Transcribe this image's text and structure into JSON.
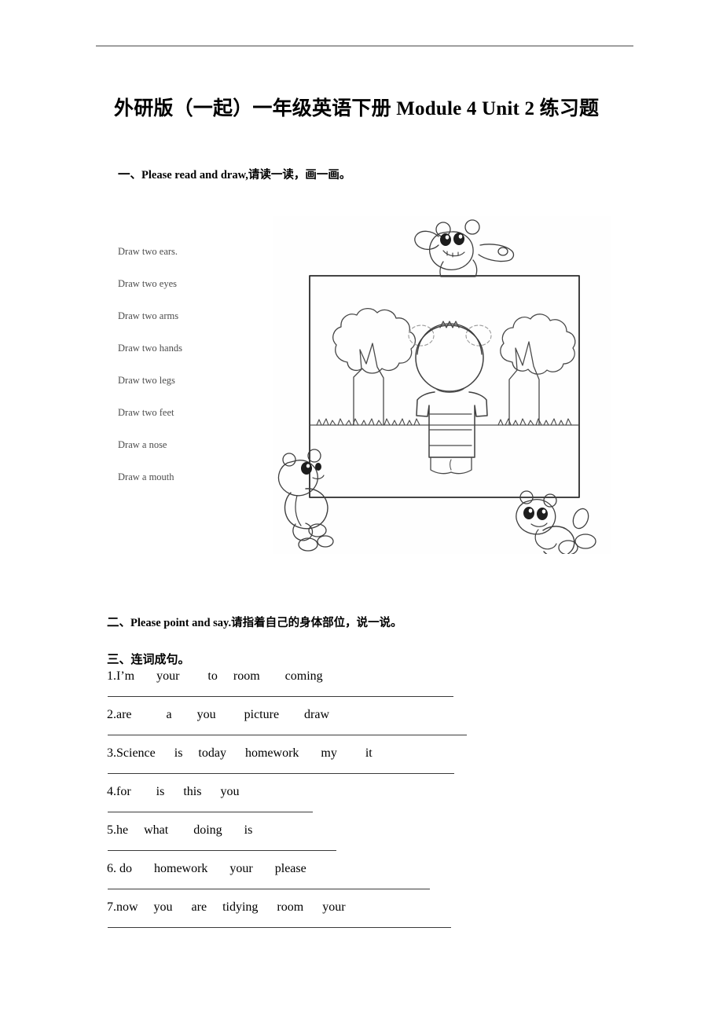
{
  "document": {
    "title": "外研版（一起）一年级英语下册 Module 4 Unit 2 练习题"
  },
  "sections": [
    {
      "number": "一",
      "mark": "、",
      "heading": "Please read and draw,请读一读，画一画。"
    },
    {
      "number": "二",
      "mark": "、",
      "heading": "Please point and say.请指着自己的身体部位，说一说。"
    },
    {
      "number": "三",
      "mark": "、",
      "heading": "连词成句。"
    }
  ],
  "exercise_one": {
    "draw_instructions": [
      "Draw two ears.",
      "Draw two eyes",
      "Draw two arms",
      "Draw two hands",
      "Draw two legs",
      "Draw two feet",
      "Draw a nose",
      "Draw a mouth"
    ],
    "picture_alt": "Line drawing of a child standing in a park with two trees, framed by a picture border, with three teddy bears around the frame"
  },
  "exercise_three": {
    "items": [
      {
        "number": "1.",
        "words": "I’m       your         to     room        coming",
        "line_width": 440
      },
      {
        "number": "2.",
        "words": "are           a        you         picture        draw",
        "line_width": 457
      },
      {
        "number": "3.",
        "words": "Science      is     today      homework       my         it",
        "line_width": 441
      },
      {
        "number": "4.",
        "words": "for        is      this      you",
        "line_width": 261
      },
      {
        "number": "5.",
        "words": "he     what        doing       is",
        "line_width": 291
      },
      {
        "number": "6.",
        "words": " do       homework       your       please",
        "line_width": 410
      },
      {
        "number": "7.",
        "words": "now     you      are     tidying      room      your",
        "line_width": 437
      }
    ]
  },
  "colors": {
    "rule": "#4a4a4a",
    "answer_line": "#3b3b3b",
    "draw_text": "#4c4c4c",
    "ink": "#000000"
  }
}
